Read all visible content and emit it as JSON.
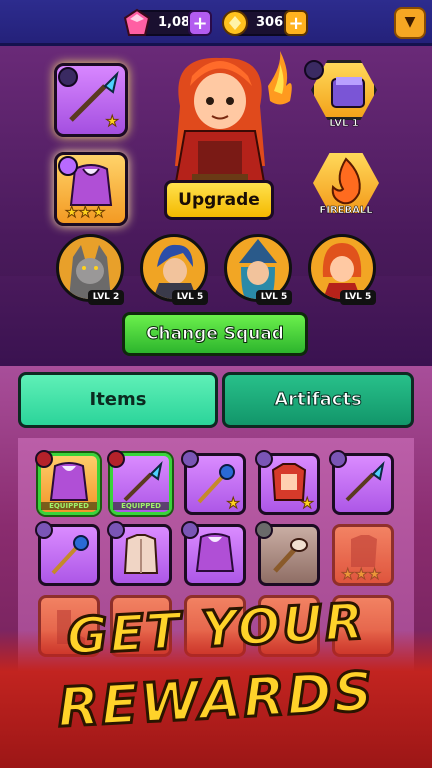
{
  "currency": {
    "gems": "1,08K",
    "coins": "306"
  },
  "hero_panel": {
    "upgrade_label": "Upgrade",
    "ability_armor_level": "LVL 1",
    "ability_fireball_label": "FIREBALL"
  },
  "squad": [
    {
      "level": "LVL 2"
    },
    {
      "level": "LVL 5"
    },
    {
      "level": "LVL 5"
    },
    {
      "level": "LVL 5"
    }
  ],
  "change_squad_label": "Change Squad",
  "tabs": {
    "items": "Items",
    "artifacts": "Artifacts"
  },
  "inventory": {
    "equipped_label": "EQUIPPED"
  },
  "banner": {
    "line1": "GET YOUR",
    "line2": "REWARDS"
  },
  "colors": {
    "accent_yellow": "#ffd32a",
    "green_button": "#2db52d",
    "tab_active": "#2bd49a"
  }
}
